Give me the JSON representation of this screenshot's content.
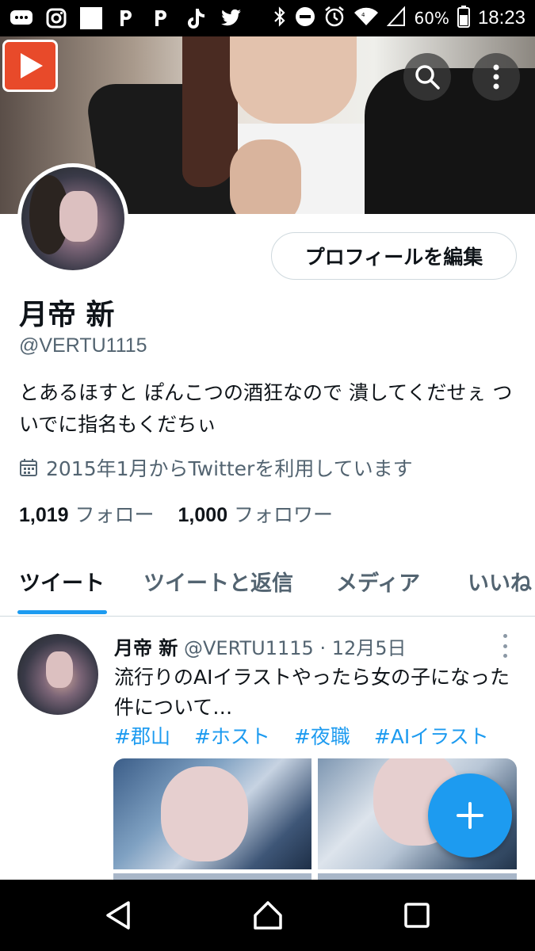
{
  "status_bar": {
    "battery": "60%",
    "time": "18:23",
    "left_icons": [
      "chat-icon",
      "instagram-icon",
      "square-icon",
      "p-icon",
      "p-icon",
      "tiktok-icon",
      "twitter-icon"
    ],
    "right_icons": [
      "bluetooth-icon",
      "dnd-icon",
      "alarm-icon",
      "wifi-icon",
      "signal-icon",
      "battery-icon"
    ]
  },
  "profile": {
    "edit_button": "プロフィールを編集",
    "name": "月帝 新",
    "handle": "@VERTU1115",
    "bio": "とあるほすと ぽんこつの酒狂なので 潰してくだせぇ ついでに指名もくだちぃ",
    "joined": "2015年1月からTwitterを利用しています",
    "following_count": "1,019",
    "following_label": "フォロー",
    "followers_count": "1,000",
    "followers_label": "フォロワー"
  },
  "tabs": [
    "ツイート",
    "ツイートと返信",
    "メディア",
    "いいね"
  ],
  "tweet": {
    "name": "月帝 新",
    "handle": "@VERTU1115",
    "separator": "·",
    "date": "12月5日",
    "text": "流行りのAIイラストやったら女の子になった件について…",
    "hashtags": [
      "#郡山",
      "#ホスト",
      "#夜職",
      "#AIイラスト"
    ]
  },
  "colors": {
    "accent": "#1d9bf0",
    "text_primary": "#0f1419",
    "text_secondary": "#536471"
  }
}
